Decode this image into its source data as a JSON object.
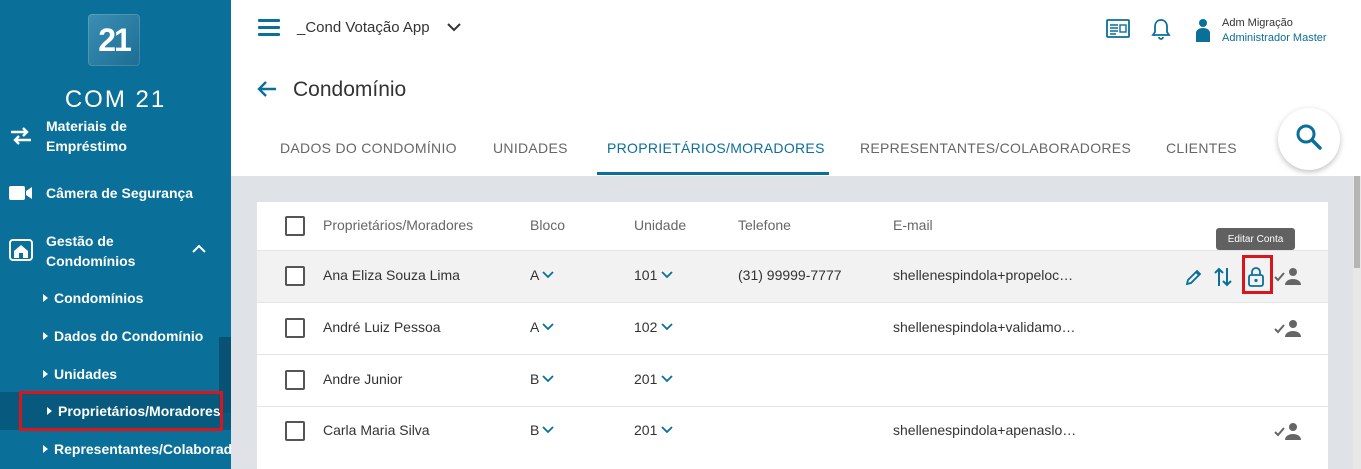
{
  "sidebar": {
    "logo_mark": "21",
    "logo_text": "COM 21",
    "items": [
      {
        "label_line1": "Materiais de",
        "label_line2": "Empréstimo",
        "icon": "swap-arrows-icon"
      },
      {
        "label": "Câmera de Segurança",
        "icon": "video-camera-icon"
      },
      {
        "label_line1": "Gestão de",
        "label_line2": "Condomínios",
        "icon": "building-icon"
      }
    ],
    "subitems": [
      {
        "label": "Condomínios"
      },
      {
        "label": "Dados do Condomínio"
      },
      {
        "label": "Unidades"
      },
      {
        "label": "Proprietários/Moradores",
        "active": true
      },
      {
        "label": "Representantes/Colaboradores"
      }
    ]
  },
  "topbar": {
    "app_title": "_Cond Votação App",
    "user_name": "Adm Migração",
    "user_role": "Administrador Master"
  },
  "page": {
    "title": "Condomínio",
    "tabs": [
      {
        "label": "DADOS DO CONDOMÍNIO"
      },
      {
        "label": "UNIDADES"
      },
      {
        "label": "PROPRIETÁRIOS/MORADORES",
        "active": true
      },
      {
        "label": "REPRESENTANTES/COLABORADORES"
      },
      {
        "label": "CLIENTES"
      }
    ]
  },
  "table": {
    "headers": [
      "Proprietários/Moradores",
      "Bloco",
      "Unidade",
      "Telefone",
      "E-mail"
    ],
    "rows": [
      {
        "name": "Ana Eliza Souza Lima",
        "bloco": "A",
        "unidade": "101",
        "telefone": "(31) 99999-7777",
        "email": "shellenespindola+propeloc…"
      },
      {
        "name": "André Luiz Pessoa",
        "bloco": "A",
        "unidade": "102",
        "telefone": "",
        "email": "shellenespindola+validamo…"
      },
      {
        "name": "Andre Junior",
        "bloco": "B",
        "unidade": "201",
        "telefone": "",
        "email": ""
      },
      {
        "name": "Carla Maria Silva",
        "bloco": "B",
        "unidade": "201",
        "telefone": "",
        "email": "shellenespindola+apenaslo…"
      }
    ],
    "tooltip": "Editar Conta"
  },
  "colors": {
    "sidebar_bg": "#0a6f99",
    "accent": "#0a6f99",
    "highlight_red": "#d9161c",
    "content_bg": "#dfe3e8"
  }
}
